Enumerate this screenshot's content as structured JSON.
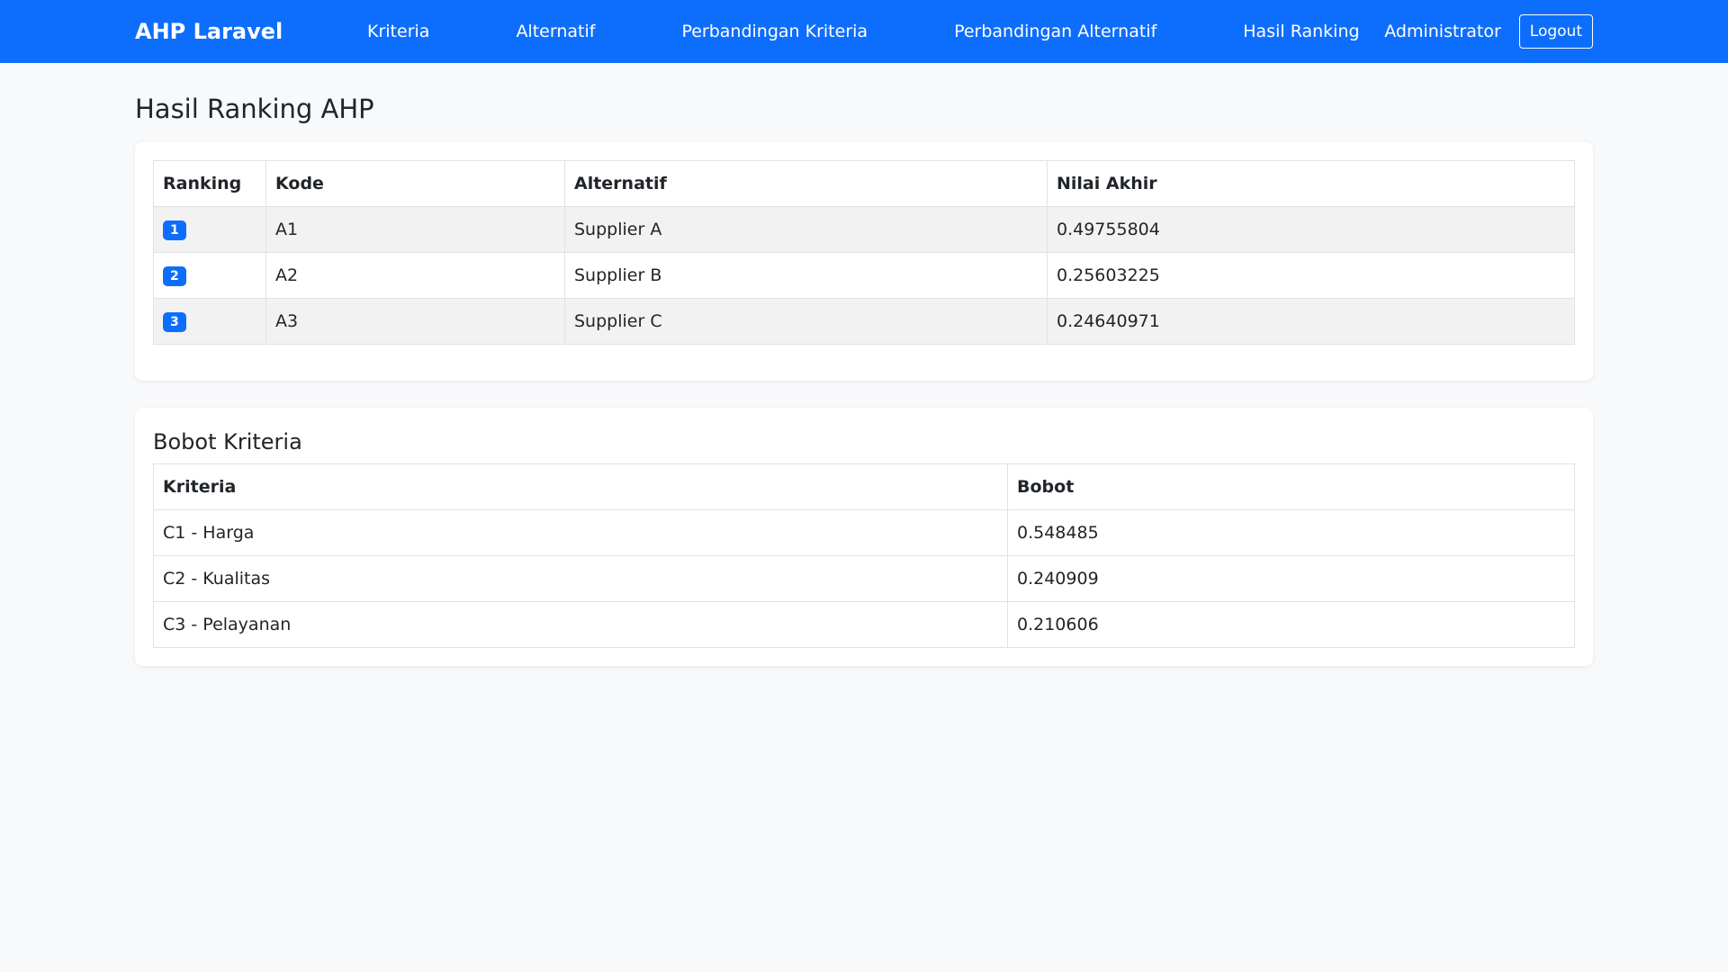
{
  "navbar": {
    "brand": "AHP Laravel",
    "links": [
      "Kriteria",
      "Alternatif",
      "Perbandingan Kriteria",
      "Perbandingan Alternatif",
      "Hasil Ranking"
    ],
    "user": "Administrator",
    "logout": "Logout"
  },
  "page": {
    "title": "Hasil Ranking AHP"
  },
  "ranking": {
    "headers": [
      "Ranking",
      "Kode",
      "Alternatif",
      "Nilai Akhir"
    ],
    "rows": [
      {
        "rank": "1",
        "kode": "A1",
        "alternatif": "Supplier A",
        "nilai": "0.49755804"
      },
      {
        "rank": "2",
        "kode": "A2",
        "alternatif": "Supplier B",
        "nilai": "0.25603225"
      },
      {
        "rank": "3",
        "kode": "A3",
        "alternatif": "Supplier C",
        "nilai": "0.24640971"
      }
    ]
  },
  "bobot": {
    "title": "Bobot Kriteria",
    "headers": [
      "Kriteria",
      "Bobot"
    ],
    "rows": [
      {
        "kriteria": "C1 - Harga",
        "bobot": "0.548485"
      },
      {
        "kriteria": "C2 - Kualitas",
        "bobot": "0.240909"
      },
      {
        "kriteria": "C3 - Pelayanan",
        "bobot": "0.210606"
      }
    ]
  },
  "colors": {
    "primary": "#0d6efd",
    "background": "#f8f9fa"
  }
}
